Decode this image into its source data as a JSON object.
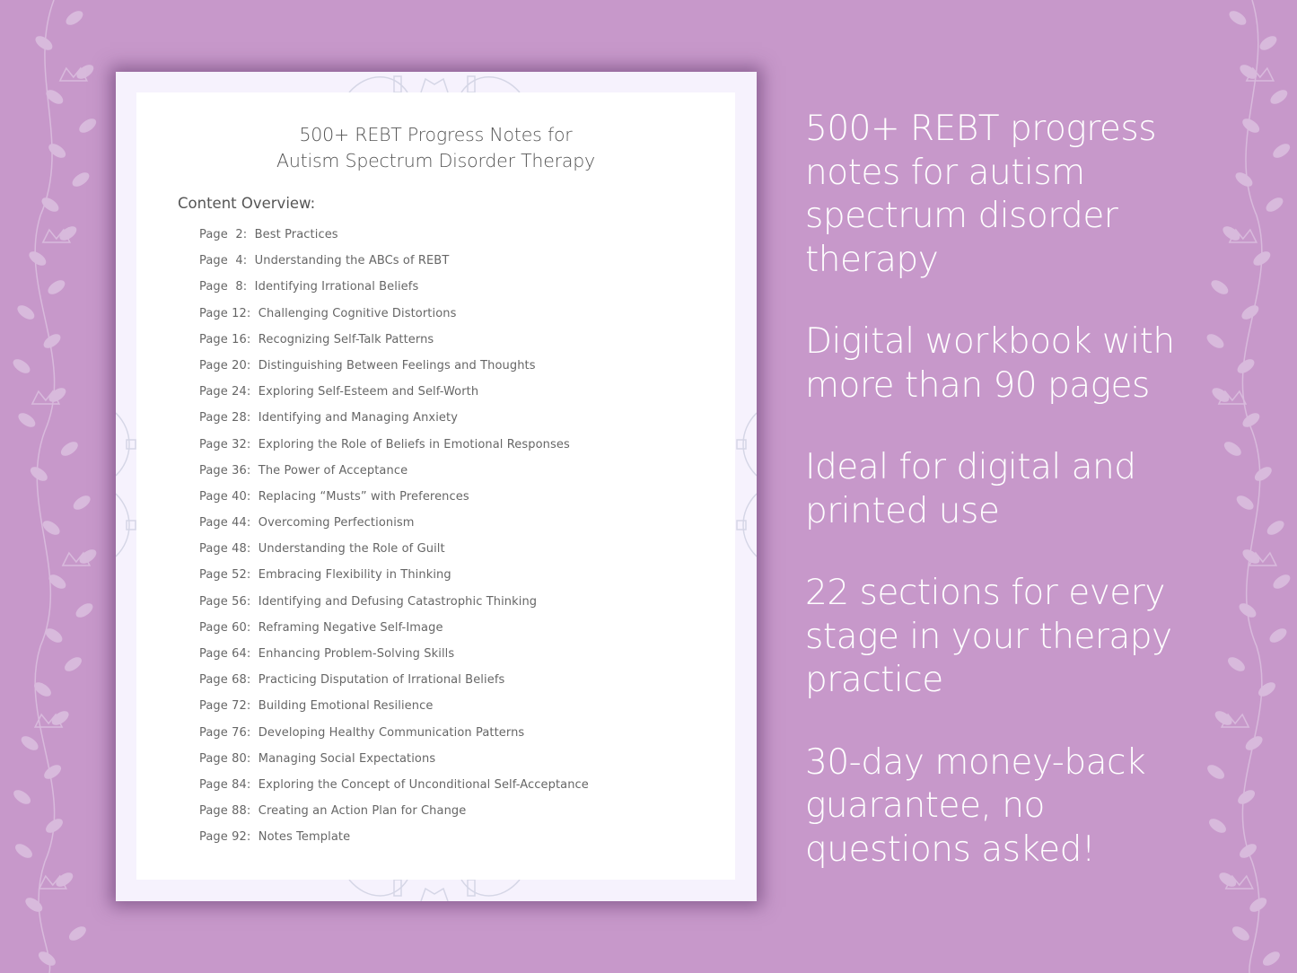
{
  "colors": {
    "background": "#c798ca",
    "page_frame": "#f6f2fd",
    "page_body": "#ffffff",
    "text_dark": "#555555",
    "text_light": "#ffffff",
    "decor": "#e3c8e6"
  },
  "document": {
    "title_line1": "500+ REBT Progress Notes for",
    "title_line2": "Autism Spectrum Disorder Therapy",
    "overview_label": "Content Overview:",
    "toc": [
      {
        "page": "Page  2:",
        "title": "Best Practices"
      },
      {
        "page": "Page  4:",
        "title": "Understanding the ABCs of REBT"
      },
      {
        "page": "Page  8:",
        "title": "Identifying Irrational Beliefs"
      },
      {
        "page": "Page 12:",
        "title": "Challenging Cognitive Distortions"
      },
      {
        "page": "Page 16:",
        "title": "Recognizing Self-Talk Patterns"
      },
      {
        "page": "Page 20:",
        "title": "Distinguishing Between Feelings and Thoughts"
      },
      {
        "page": "Page 24:",
        "title": "Exploring Self-Esteem and Self-Worth"
      },
      {
        "page": "Page 28:",
        "title": "Identifying and Managing Anxiety"
      },
      {
        "page": "Page 32:",
        "title": "Exploring the Role of Beliefs in Emotional Responses"
      },
      {
        "page": "Page 36:",
        "title": "The Power of Acceptance"
      },
      {
        "page": "Page 40:",
        "title": "Replacing “Musts” with Preferences"
      },
      {
        "page": "Page 44:",
        "title": "Overcoming Perfectionism"
      },
      {
        "page": "Page 48:",
        "title": "Understanding the Role of Guilt"
      },
      {
        "page": "Page 52:",
        "title": "Embracing Flexibility in Thinking"
      },
      {
        "page": "Page 56:",
        "title": "Identifying and Defusing Catastrophic Thinking"
      },
      {
        "page": "Page 60:",
        "title": "Reframing Negative Self-Image"
      },
      {
        "page": "Page 64:",
        "title": "Enhancing Problem-Solving Skills"
      },
      {
        "page": "Page 68:",
        "title": "Practicing Disputation of Irrational Beliefs"
      },
      {
        "page": "Page 72:",
        "title": "Building Emotional Resilience"
      },
      {
        "page": "Page 76:",
        "title": "Developing Healthy Communication Patterns"
      },
      {
        "page": "Page 80:",
        "title": "Managing Social Expectations"
      },
      {
        "page": "Page 84:",
        "title": "Exploring the Concept of Unconditional Self-Acceptance"
      },
      {
        "page": "Page 88:",
        "title": "Creating an Action Plan for Change"
      },
      {
        "page": "Page 92:",
        "title": "Notes Template"
      }
    ]
  },
  "features": [
    {
      "text": "500+ REBT progress notes for autism spectrum disorder therapy"
    },
    {
      "text": "Digital workbook with more than 90 pages"
    },
    {
      "text": "Ideal for digital and printed use"
    },
    {
      "text": "22 sections for every stage in your therapy practice"
    },
    {
      "text": "30-day money-back guarantee, no questions asked!"
    }
  ],
  "icons": {
    "left_vine": "floral-vine-icon",
    "right_vine": "floral-vine-icon",
    "mandala": "mandala-icon"
  }
}
